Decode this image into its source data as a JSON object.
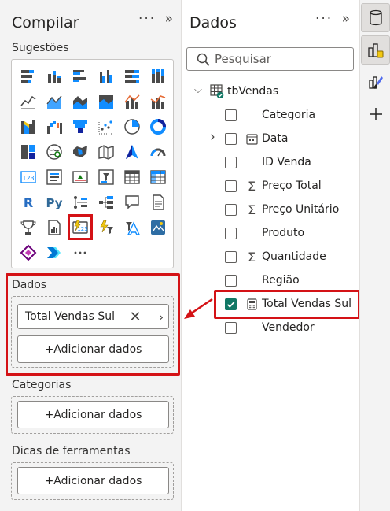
{
  "build": {
    "title": "Compilar",
    "more_icon": "···",
    "collapse_icon": "»",
    "suggestions_label": "Sugestões",
    "more_visuals": "···",
    "visuals": [
      "stacked-bar-chart-icon",
      "stacked-column-chart-icon",
      "clustered-bar-chart-icon",
      "clustered-column-chart-icon",
      "100-stacked-bar-chart-icon",
      "100-stacked-column-chart-icon",
      "line-chart-icon",
      "area-chart-icon",
      "stacked-area-chart-icon",
      "100-stacked-area-chart-icon",
      "line-clustered-column-chart-icon",
      "line-stacked-column-chart-icon",
      "ribbon-chart-icon",
      "waterfall-chart-icon",
      "funnel-chart-icon",
      "scatter-chart-icon",
      "pie-chart-icon",
      "donut-chart-icon",
      "treemap-icon",
      "map-icon",
      "filled-map-icon",
      "shape-map-icon",
      "azure-map-icon",
      "gauge-icon",
      "card-icon",
      "multi-row-card-icon",
      "kpi-icon",
      "slicer-icon",
      "table-icon",
      "matrix-icon",
      "r-visual-icon",
      "python-visual-icon",
      "key-influencers-icon",
      "decomposition-tree-icon",
      "qa-icon",
      "smart-narrative-icon",
      "metrics-icon",
      "paginated-report-icon",
      "card-new-icon",
      "power-automate-icon",
      "power-apps-icon",
      "arcgis-map-icon",
      "copilot-icon",
      "narrative-chevron-icon",
      "more-visuals-icon"
    ],
    "selected_visual": "card-new-icon",
    "values_well": {
      "label": "Dados",
      "field": "Total Vendas Sul",
      "add_label": "+Adicionar dados"
    },
    "category_well": {
      "label": "Categorias",
      "add_label": "+Adicionar dados"
    },
    "tooltips_well": {
      "label": "Dicas de ferramentas",
      "add_label": "+Adicionar dados"
    }
  },
  "data_pane": {
    "title": "Dados",
    "more_icon": "···",
    "collapse_icon": "»",
    "search_placeholder": "Pesquisar",
    "table": "tbVendas",
    "fields": [
      {
        "name": "Categoria",
        "type": "text",
        "checked": false,
        "expandable": false
      },
      {
        "name": "Data",
        "type": "date-hierarchy",
        "checked": false,
        "expandable": true
      },
      {
        "name": "ID Venda",
        "type": "text",
        "checked": false,
        "expandable": false
      },
      {
        "name": "Preço Total",
        "type": "sum",
        "checked": false,
        "expandable": false
      },
      {
        "name": "Preço Unitário",
        "type": "sum",
        "checked": false,
        "expandable": false
      },
      {
        "name": "Produto",
        "type": "text",
        "checked": false,
        "expandable": false
      },
      {
        "name": "Quantidade",
        "type": "sum",
        "checked": false,
        "expandable": false
      },
      {
        "name": "Região",
        "type": "text",
        "checked": false,
        "expandable": false
      },
      {
        "name": "Total Vendas Sul",
        "type": "measure",
        "checked": true,
        "expandable": false
      },
      {
        "name": "Vendedor",
        "type": "text",
        "checked": false,
        "expandable": false
      }
    ]
  },
  "rail": {
    "buttons": [
      "data-cylinder-icon",
      "build-visual-icon",
      "format-brush-icon",
      "add-icon"
    ]
  },
  "colors": {
    "highlight_red": "#d41216",
    "check_green": "#117865",
    "pane_bg": "#f3f3f3"
  }
}
